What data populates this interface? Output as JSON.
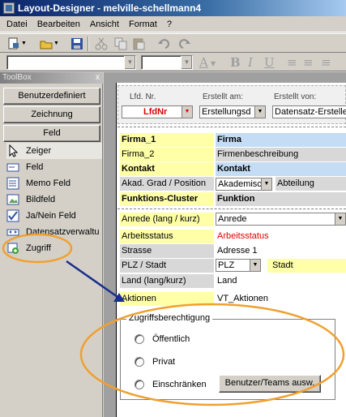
{
  "window": {
    "title": "Layout-Designer - melville-schellmann4"
  },
  "menu": [
    "Datei",
    "Bearbeiten",
    "Ansicht",
    "Format",
    "?"
  ],
  "toolbar": {
    "icons": [
      "new-icon",
      "open-icon",
      "save-icon",
      "cut-icon",
      "copy-icon",
      "paste-icon",
      "undo-icon",
      "redo-icon"
    ],
    "format_icons": [
      "A",
      "B",
      "I",
      "U",
      "≡",
      "≡",
      "≡"
    ]
  },
  "toolbox": {
    "title": "ToolBox",
    "close": "x",
    "buttons": [
      "Benutzerdefiniert",
      "Zeichnung",
      "Feld"
    ],
    "tools": [
      {
        "label": "Zeiger",
        "icon": "pointer-icon"
      },
      {
        "label": "Feld",
        "icon": "field-icon"
      },
      {
        "label": "Memo Feld",
        "icon": "memo-field-icon"
      },
      {
        "label": "Bildfeld",
        "icon": "image-field-icon"
      },
      {
        "label": "Ja/Nein Feld",
        "icon": "checkbox-field-icon"
      },
      {
        "label": "Datensatzverwaltu",
        "icon": "record-nav-icon"
      },
      {
        "label": "Zugriff",
        "icon": "access-icon"
      }
    ]
  },
  "header": {
    "lfd_label": "Lfd. Nr.",
    "lfd_value": "LfdNr",
    "erstellt_am_label": "Erstellt am:",
    "erstellt_am_value": "Erstellungsd",
    "erstellt_von_label": "Erstellt von:",
    "erstellt_von_value": "Datensatz-Ersteller"
  },
  "rows": [
    {
      "label": "Firma_1",
      "value": "Firma"
    },
    {
      "label": "Firma_2",
      "value": "Firmenbeschreibung"
    },
    {
      "label": "Kontakt",
      "value": "Kontakt"
    },
    {
      "label": "Akad. Grad / Position",
      "value": "Akademisc",
      "value2": "Abteilung"
    },
    {
      "label": "Funktions-Cluster",
      "value": "Funktion"
    },
    {
      "label": "Anrede (lang / kurz)",
      "value": "Anrede"
    },
    {
      "label": "Arbeitsstatus",
      "value": "Arbeitsstatus"
    },
    {
      "label": "Strasse",
      "value": "Adresse 1"
    },
    {
      "label": "PLZ / Stadt",
      "value": "PLZ",
      "value2": "Stadt"
    },
    {
      "label": "Land (lang/kurz)",
      "value": "Land"
    },
    {
      "label": "Aktionen",
      "value": "VT_Aktionen"
    }
  ],
  "access_group": {
    "title": "Zugriffsberechtigung",
    "options": [
      "Öffentlich",
      "Privat",
      "Einschränken"
    ],
    "button": "Benutzer/Teams ausw."
  },
  "colors": {
    "title_bar": "#0a246a",
    "label_yellow": "#ffffa8",
    "value_blue": "#c4dcf4",
    "annotation_orange": "#f0a030",
    "arrow_blue": "#1a2e8c",
    "status_red": "#e00000"
  }
}
